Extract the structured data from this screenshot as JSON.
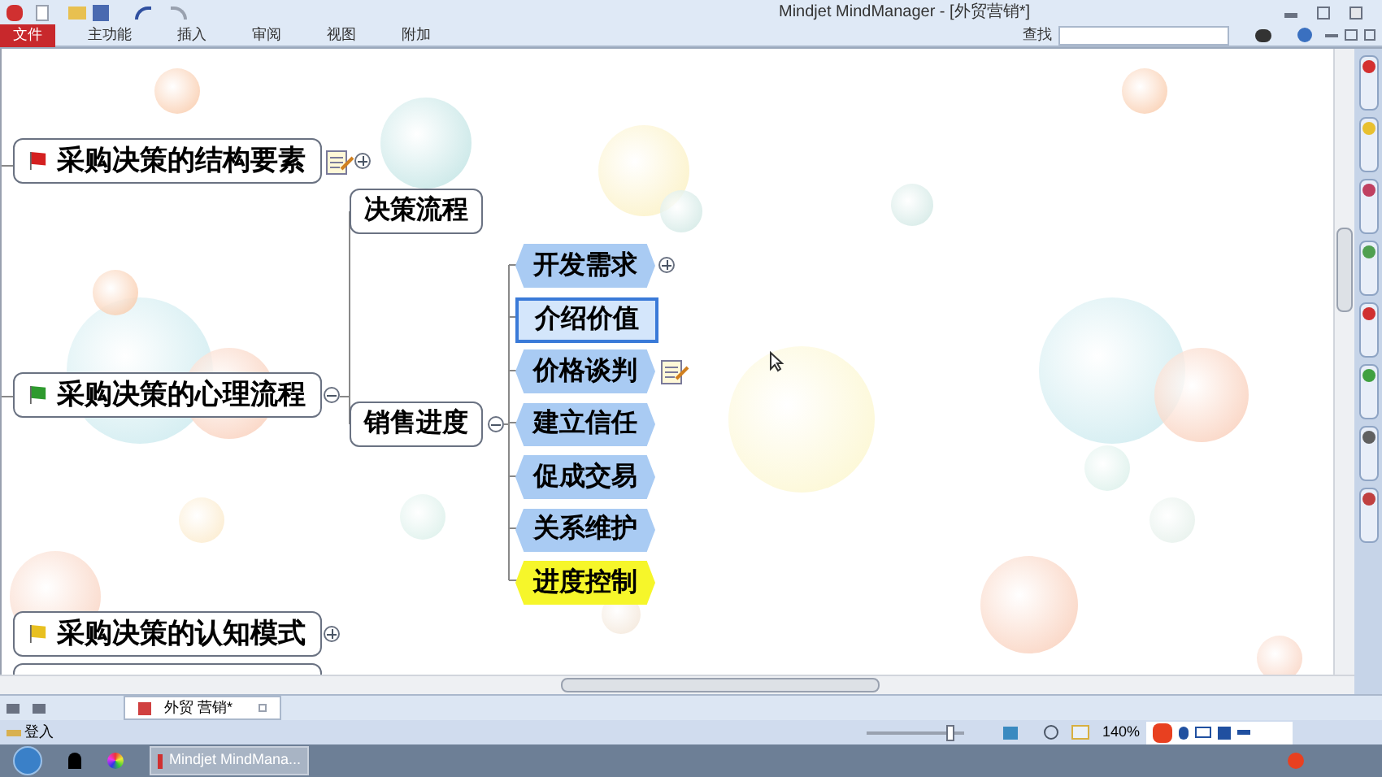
{
  "window": {
    "title": "Mindjet MindManager - [外贸营销*]"
  },
  "ribbon_tabs": [
    {
      "label": "文件",
      "selected": true
    },
    {
      "label": "主功能",
      "selected": false
    },
    {
      "label": "插入",
      "selected": false
    },
    {
      "label": "审阅",
      "selected": false
    },
    {
      "label": "视图",
      "selected": false
    },
    {
      "label": "附加",
      "selected": false
    }
  ],
  "search": {
    "label": "查找"
  },
  "map": {
    "topics": [
      {
        "text": "采购决策的结构要素",
        "color": "#d42020",
        "expanded": false,
        "has_note": true
      },
      {
        "text": "采购决策的心理流程",
        "color": "#2e9a2e",
        "expanded": true,
        "has_note": false,
        "children": [
          {
            "text": "决策流程"
          },
          {
            "text": "销售进度",
            "expanded": true,
            "children": [
              {
                "text": "开发需求",
                "color": "#a9cbf3",
                "selected": false,
                "expanded": false,
                "has_note": false
              },
              {
                "text": "介绍价值",
                "color": "#d4e6fb",
                "selected": true,
                "has_note": false
              },
              {
                "text": "价格谈判",
                "color": "#a9cbf3",
                "selected": false,
                "has_note": true
              },
              {
                "text": "建立信任",
                "color": "#a9cbf3",
                "selected": false,
                "has_note": false
              },
              {
                "text": "促成交易",
                "color": "#a9cbf3",
                "selected": false,
                "has_note": false
              },
              {
                "text": "关系维护",
                "color": "#a9cbf3",
                "selected": false,
                "has_note": false
              },
              {
                "text": "进度控制",
                "color": "#f6f62a",
                "selected": false,
                "has_note": false
              }
            ]
          }
        ]
      },
      {
        "text": "采购决策的认知模式",
        "color": "#e8c020",
        "expanded": false,
        "has_note": false
      }
    ]
  },
  "document_tabs": [
    {
      "label": "外贸 营销*",
      "selected": true
    }
  ],
  "status_bar": {
    "login": "登入",
    "zoom": "140%",
    "zoom_slider": {
      "level": 0.85
    }
  },
  "taskbar": {
    "window_button": "Mindjet MindMana..."
  }
}
